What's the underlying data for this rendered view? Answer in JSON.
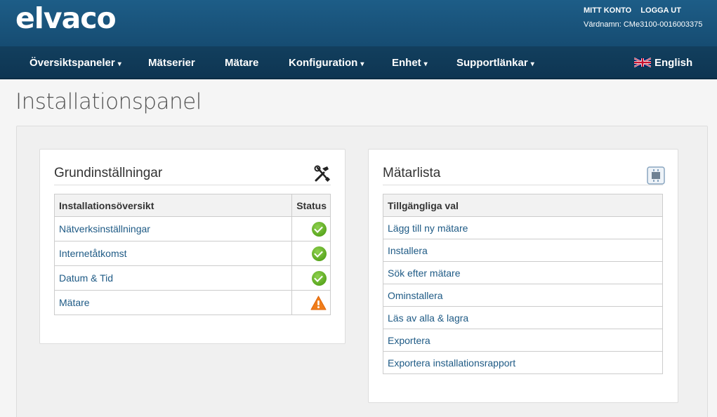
{
  "header": {
    "logo": "elvaco",
    "account_link": "MITT KONTO",
    "logout_link": "LOGGA UT",
    "hostname": "Värdnamn: CMe3100-0016003375"
  },
  "nav": {
    "items": [
      {
        "label": "Översiktspaneler",
        "caret": "▾"
      },
      {
        "label": "Mätserier",
        "caret": ""
      },
      {
        "label": "Mätare",
        "caret": ""
      },
      {
        "label": "Konfiguration",
        "caret": "▾"
      },
      {
        "label": "Enhet",
        "caret": "▾"
      },
      {
        "label": "Supportlänkar",
        "caret": "▾"
      }
    ],
    "language": "English"
  },
  "page": {
    "title": "Installationspanel"
  },
  "basic_settings": {
    "title": "Grundinställningar",
    "icon": "tools-icon",
    "header_col1": "Installationsöversikt",
    "header_col2": "Status",
    "rows": [
      {
        "label": "Nätverksinställningar",
        "status": "ok"
      },
      {
        "label": "Internetåtkomst",
        "status": "ok"
      },
      {
        "label": "Datum & Tid",
        "status": "ok"
      },
      {
        "label": "Mätare",
        "status": "warning"
      }
    ]
  },
  "meter_list": {
    "title": "Mätarlista",
    "icon": "meter-icon",
    "header": "Tillgängliga val",
    "items": [
      "Lägg till ny mätare",
      "Installera",
      "Sök efter mätare",
      "Ominstallera",
      "Läs av alla & lagra",
      "Exportera",
      "Exportera installationsrapport"
    ]
  },
  "colors": {
    "header": "#1d5d87",
    "navbar": "#123f5e",
    "link": "#1e5a85",
    "ok": "#5aa71f",
    "warning": "#f07d1a"
  }
}
